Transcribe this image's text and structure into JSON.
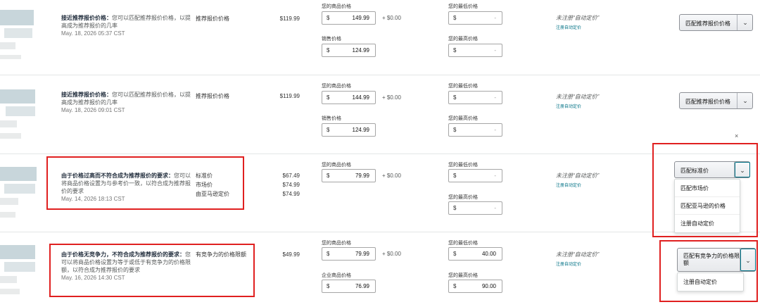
{
  "labels": {
    "your_price": "您的商品价格",
    "sale_price": "销售价格",
    "business_price": "企业商品价格",
    "min_price": "您的最低价格",
    "max_price": "您的最高价格",
    "currency": "$",
    "shipping": "+ $0.00",
    "dash": "-",
    "auto_pricing": "未注册“自动定价”",
    "register_auto": "注册自动定价"
  },
  "rows": [
    {
      "status_bold": "接近推荐报价价格：",
      "status_desc": "您可以匹配推荐报价价格，以提高成为推荐报价的几率",
      "date": "May. 18, 2026 05:37 CST",
      "price_type": "推荐报价价格",
      "price_value": "$119.99",
      "your_price": "149.99",
      "second_price": "124.99",
      "min_price": "",
      "max_price": "",
      "button_label": "匹配推荐报价价格"
    },
    {
      "status_bold": "接近推荐报价价格：",
      "status_desc": "您可以匹配推荐报价价格，以提高成为推荐报价的几率",
      "date": "May. 18, 2026 09:01 CST",
      "price_type": "推荐报价价格",
      "price_value": "$119.99",
      "your_price": "144.99",
      "second_price": "124.99",
      "min_price": "",
      "max_price": "",
      "button_label": "匹配推荐报价价格"
    },
    {
      "status_bold": "由于价格过高而不符合成为推荐报价的要求：",
      "status_desc": "您可以将商品价格设置为与参考价一致，以符合成为推荐报价的要求",
      "date": "May. 14, 2026 18:13 CST",
      "price_types": [
        "标准价",
        "市场价",
        "由亚马逊定价"
      ],
      "price_values": [
        "$67.49",
        "$74.99",
        "$74.99"
      ],
      "your_price": "79.99",
      "min_price": "",
      "max_price": "",
      "button_label": "匹配标准价",
      "menu": [
        "匹配市场价",
        "匹配亚马逊的价格",
        "注册自动定价"
      ]
    },
    {
      "status_bold": "由于价格无竞争力，不符合成为推荐报价的要求：",
      "status_desc": "您可以将商品价格设置为等于或低于有竞争力的价格限额，以符合成为推荐报价的要求",
      "date": "May. 16, 2026 14:30 CST",
      "price_type": "有竞争力的价格限额",
      "price_value": "$49.99",
      "your_price": "79.99",
      "second_price": "76.99",
      "min_price": "40.00",
      "max_price": "90.00",
      "button_label": "匹配有竞争力的价格限额",
      "menu": [
        "注册自动定价"
      ]
    }
  ],
  "colors": {
    "highlight": "#e02020",
    "link": "#007185",
    "border": "#e3e6e6"
  }
}
